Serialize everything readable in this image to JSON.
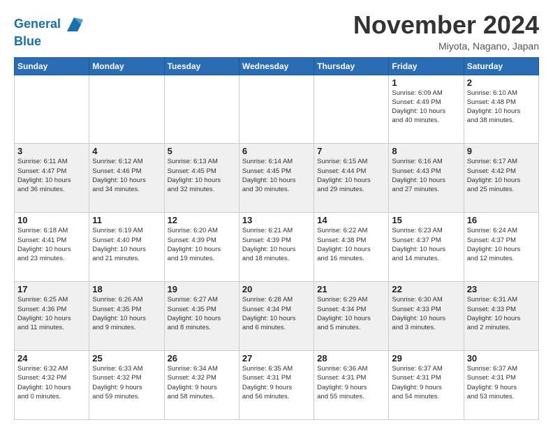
{
  "header": {
    "logo_line1": "General",
    "logo_line2": "Blue",
    "month_title": "November 2024",
    "location": "Miyota, Nagano, Japan"
  },
  "days_of_week": [
    "Sunday",
    "Monday",
    "Tuesday",
    "Wednesday",
    "Thursday",
    "Friday",
    "Saturday"
  ],
  "weeks": [
    [
      {
        "day": "",
        "info": ""
      },
      {
        "day": "",
        "info": ""
      },
      {
        "day": "",
        "info": ""
      },
      {
        "day": "",
        "info": ""
      },
      {
        "day": "",
        "info": ""
      },
      {
        "day": "1",
        "info": "Sunrise: 6:09 AM\nSunset: 4:49 PM\nDaylight: 10 hours\nand 40 minutes."
      },
      {
        "day": "2",
        "info": "Sunrise: 6:10 AM\nSunset: 4:48 PM\nDaylight: 10 hours\nand 38 minutes."
      }
    ],
    [
      {
        "day": "3",
        "info": "Sunrise: 6:11 AM\nSunset: 4:47 PM\nDaylight: 10 hours\nand 36 minutes."
      },
      {
        "day": "4",
        "info": "Sunrise: 6:12 AM\nSunset: 4:46 PM\nDaylight: 10 hours\nand 34 minutes."
      },
      {
        "day": "5",
        "info": "Sunrise: 6:13 AM\nSunset: 4:45 PM\nDaylight: 10 hours\nand 32 minutes."
      },
      {
        "day": "6",
        "info": "Sunrise: 6:14 AM\nSunset: 4:45 PM\nDaylight: 10 hours\nand 30 minutes."
      },
      {
        "day": "7",
        "info": "Sunrise: 6:15 AM\nSunset: 4:44 PM\nDaylight: 10 hours\nand 29 minutes."
      },
      {
        "day": "8",
        "info": "Sunrise: 6:16 AM\nSunset: 4:43 PM\nDaylight: 10 hours\nand 27 minutes."
      },
      {
        "day": "9",
        "info": "Sunrise: 6:17 AM\nSunset: 4:42 PM\nDaylight: 10 hours\nand 25 minutes."
      }
    ],
    [
      {
        "day": "10",
        "info": "Sunrise: 6:18 AM\nSunset: 4:41 PM\nDaylight: 10 hours\nand 23 minutes."
      },
      {
        "day": "11",
        "info": "Sunrise: 6:19 AM\nSunset: 4:40 PM\nDaylight: 10 hours\nand 21 minutes."
      },
      {
        "day": "12",
        "info": "Sunrise: 6:20 AM\nSunset: 4:39 PM\nDaylight: 10 hours\nand 19 minutes."
      },
      {
        "day": "13",
        "info": "Sunrise: 6:21 AM\nSunset: 4:39 PM\nDaylight: 10 hours\nand 18 minutes."
      },
      {
        "day": "14",
        "info": "Sunrise: 6:22 AM\nSunset: 4:38 PM\nDaylight: 10 hours\nand 16 minutes."
      },
      {
        "day": "15",
        "info": "Sunrise: 6:23 AM\nSunset: 4:37 PM\nDaylight: 10 hours\nand 14 minutes."
      },
      {
        "day": "16",
        "info": "Sunrise: 6:24 AM\nSunset: 4:37 PM\nDaylight: 10 hours\nand 12 minutes."
      }
    ],
    [
      {
        "day": "17",
        "info": "Sunrise: 6:25 AM\nSunset: 4:36 PM\nDaylight: 10 hours\nand 11 minutes."
      },
      {
        "day": "18",
        "info": "Sunrise: 6:26 AM\nSunset: 4:35 PM\nDaylight: 10 hours\nand 9 minutes."
      },
      {
        "day": "19",
        "info": "Sunrise: 6:27 AM\nSunset: 4:35 PM\nDaylight: 10 hours\nand 8 minutes."
      },
      {
        "day": "20",
        "info": "Sunrise: 6:28 AM\nSunset: 4:34 PM\nDaylight: 10 hours\nand 6 minutes."
      },
      {
        "day": "21",
        "info": "Sunrise: 6:29 AM\nSunset: 4:34 PM\nDaylight: 10 hours\nand 5 minutes."
      },
      {
        "day": "22",
        "info": "Sunrise: 6:30 AM\nSunset: 4:33 PM\nDaylight: 10 hours\nand 3 minutes."
      },
      {
        "day": "23",
        "info": "Sunrise: 6:31 AM\nSunset: 4:33 PM\nDaylight: 10 hours\nand 2 minutes."
      }
    ],
    [
      {
        "day": "24",
        "info": "Sunrise: 6:32 AM\nSunset: 4:32 PM\nDaylight: 10 hours\nand 0 minutes."
      },
      {
        "day": "25",
        "info": "Sunrise: 6:33 AM\nSunset: 4:32 PM\nDaylight: 9 hours\nand 59 minutes."
      },
      {
        "day": "26",
        "info": "Sunrise: 6:34 AM\nSunset: 4:32 PM\nDaylight: 9 hours\nand 58 minutes."
      },
      {
        "day": "27",
        "info": "Sunrise: 6:35 AM\nSunset: 4:31 PM\nDaylight: 9 hours\nand 56 minutes."
      },
      {
        "day": "28",
        "info": "Sunrise: 6:36 AM\nSunset: 4:31 PM\nDaylight: 9 hours\nand 55 minutes."
      },
      {
        "day": "29",
        "info": "Sunrise: 6:37 AM\nSunset: 4:31 PM\nDaylight: 9 hours\nand 54 minutes."
      },
      {
        "day": "30",
        "info": "Sunrise: 6:37 AM\nSunset: 4:31 PM\nDaylight: 9 hours\nand 53 minutes."
      }
    ]
  ]
}
